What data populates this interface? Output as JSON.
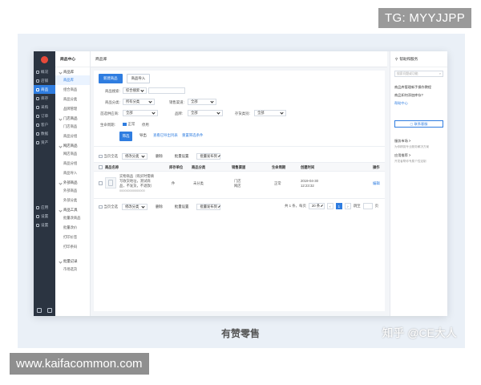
{
  "watermarks": {
    "top_right": "TG: MYYJJPP",
    "bottom_left": "www.kaifacommon.com",
    "zhihu": "知乎 @CE大人"
  },
  "caption": "有赞零售",
  "rail": {
    "items": [
      {
        "label": "概况"
      },
      {
        "label": "店铺"
      },
      {
        "label": "商品",
        "active": true
      },
      {
        "label": "库存"
      },
      {
        "label": "采购"
      },
      {
        "label": "订单"
      },
      {
        "label": "客户"
      },
      {
        "label": "数据"
      },
      {
        "label": "资产"
      }
    ],
    "lower_items": [
      {
        "label": "应用"
      },
      {
        "label": "设置"
      },
      {
        "label": "设置"
      }
    ]
  },
  "sub": {
    "header": "商品中心",
    "groups": [
      {
        "title": "商品库",
        "items": [
          "商品库",
          "组合商品",
          "商品分类",
          "品牌管理"
        ]
      },
      {
        "title": "门店商品",
        "items": [
          "门店商品",
          "商品分组"
        ]
      },
      {
        "title": "网店商品",
        "items": [
          "网店商品",
          "商品分组",
          "商品导入"
        ]
      },
      {
        "title": "外部商品",
        "items": [
          "外部商品",
          "外部分类"
        ]
      },
      {
        "title": "商品工具",
        "items": [
          "批量改商品",
          "批量改价",
          "打印价签",
          "打印条码"
        ]
      },
      {
        "title": "批量记录",
        "items": [
          "市场选货"
        ]
      }
    ],
    "active_item": "商品库"
  },
  "topbar": {
    "title": "商品库"
  },
  "toolbar": {
    "new_label": "新建商品",
    "import_label": "商品导入"
  },
  "filters": {
    "search_label": "商品搜索:",
    "search_type": "综合搜索",
    "category_label": "商品分类:",
    "category_value": "所有分类",
    "channel_label": "销售渠道:",
    "channel_value": "全部",
    "supplier_label": "首选供应商:",
    "supplier_value": "全部",
    "brand_label": "品牌:",
    "brand_value": "全部",
    "stock_label": "存货类别:",
    "stock_value": "全部",
    "status_label": "生命周期:",
    "status_on": "正常",
    "status_off": "停用",
    "filter_btn": "筛选",
    "export_btn": "导出",
    "show_exports": "查看已导出列表",
    "reset": "重置筛选条件"
  },
  "bulk": {
    "select_page": "当页全选",
    "modify_category": "修改分类",
    "delete": "删除",
    "batch_set": "批量设置",
    "batch_publish": "批量发布到"
  },
  "table": {
    "headers": [
      "商品名称",
      "库存单位",
      "商品分类",
      "销售渠道",
      "生命周期",
      "创建时间",
      "操作"
    ],
    "rows": [
      {
        "name_line1": "实物商品（购买时需填",
        "name_line2": "写收货地址，测试商",
        "name_line3": "品，不发货，不退款）",
        "code": "000000000000000",
        "unit": "件",
        "category": "未分类",
        "channel_line1": "门店",
        "channel_line2": "网店",
        "status": "正常",
        "created_line1": "2019-04-30",
        "created_line2": "12:23:32",
        "action": "编辑"
      }
    ]
  },
  "pagination": {
    "summary": "共 1 条，每页",
    "page_size": "20 条",
    "current": "1",
    "jump": "跳至",
    "page_unit": "页"
  },
  "footer": {
    "logo": "有赞"
  },
  "help": {
    "title": "帮助和服务",
    "search_placeholder": "搜索问题或功能",
    "links": [
      "商品库管理新手操作教程",
      "商品如何添加库存?",
      "帮助中心"
    ],
    "contact": "联系客服",
    "market_title": "服务市场 >",
    "market_desc": "为你精挑专业服务解决方案",
    "app_title": "应用推荐 >",
    "app_desc": "开发者帮你专属个性定制"
  }
}
